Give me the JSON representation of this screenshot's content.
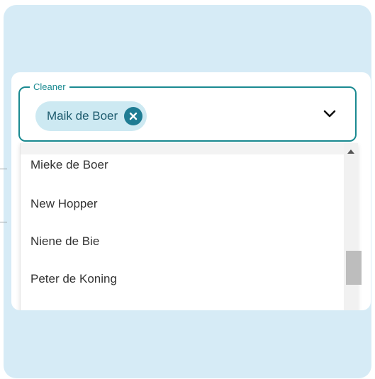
{
  "field": {
    "label": "Cleaner",
    "selected_chip": "Maik de Boer",
    "chip_remove_icon": "close-circle-icon",
    "toggle_icon": "chevron-down-icon"
  },
  "dropdown": {
    "options": [
      "Mieke de Boer",
      "New Hopper",
      "Niene de Bie",
      "Peter de Koning"
    ],
    "scroll_icon": "arrow-up-icon"
  },
  "colors": {
    "accent": "#1a8a91",
    "chip_bg": "#cde9f2",
    "chip_close_bg": "#1f7c93",
    "backdrop": "#d6ebf6"
  }
}
